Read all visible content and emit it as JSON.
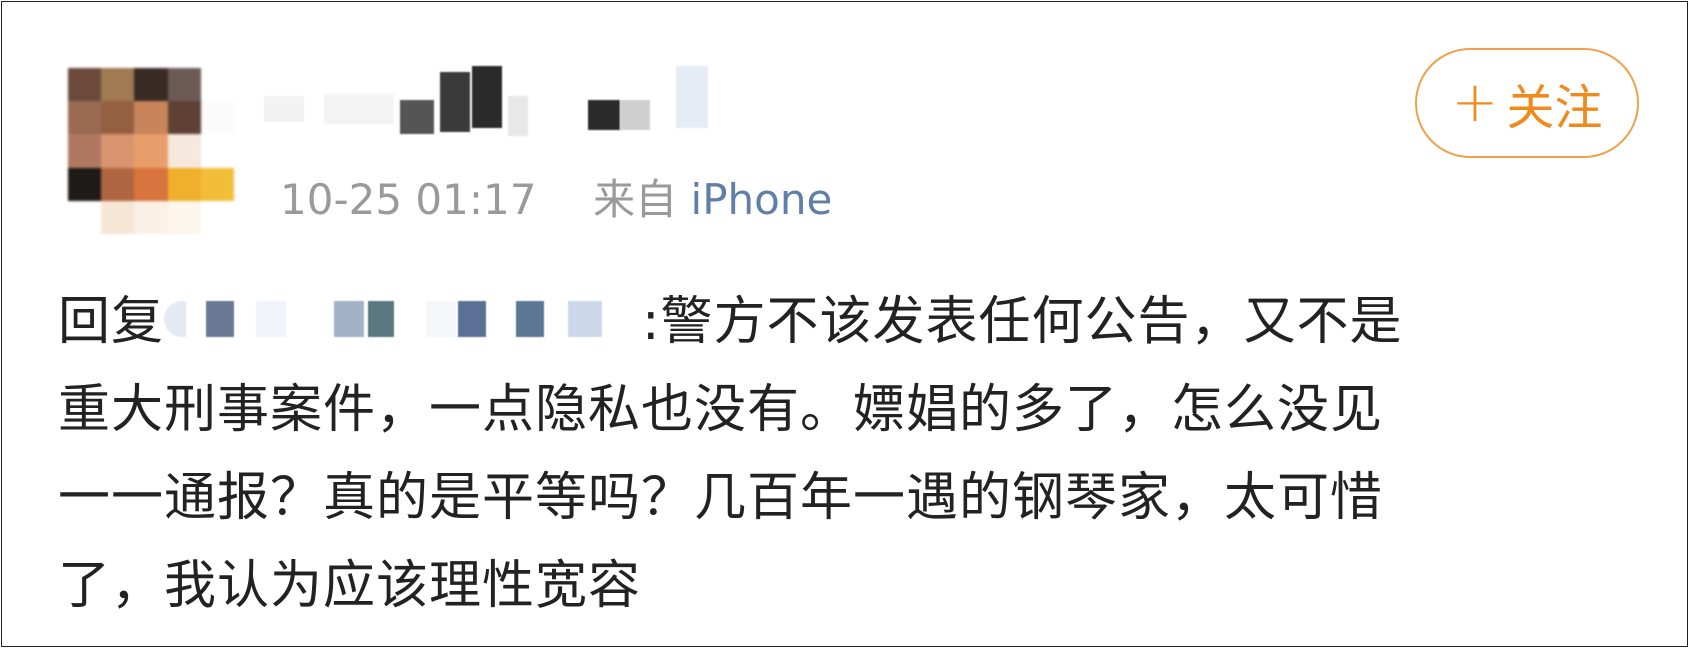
{
  "post": {
    "timestamp": "10-25 01:17",
    "source_prefix": "来自",
    "source_device": "iPhone",
    "follow_button": {
      "plus": "+",
      "label": "关注"
    },
    "reply_prefix": "回复",
    "content_lines": [
      ":警方不该发表任何公告，又不是",
      "重大刑事案件，一点隐私也没有。嫖娼的多了，怎么没见",
      "一一通报？真的是平等吗？几百年一遇的钢琴家，太可惜",
      "了，我认为应该理性宽容"
    ]
  },
  "colors": {
    "accent_orange": "#f08a1c",
    "link_blue": "#5f7fa6",
    "meta_gray": "#9a9a9a",
    "text": "#222222"
  }
}
